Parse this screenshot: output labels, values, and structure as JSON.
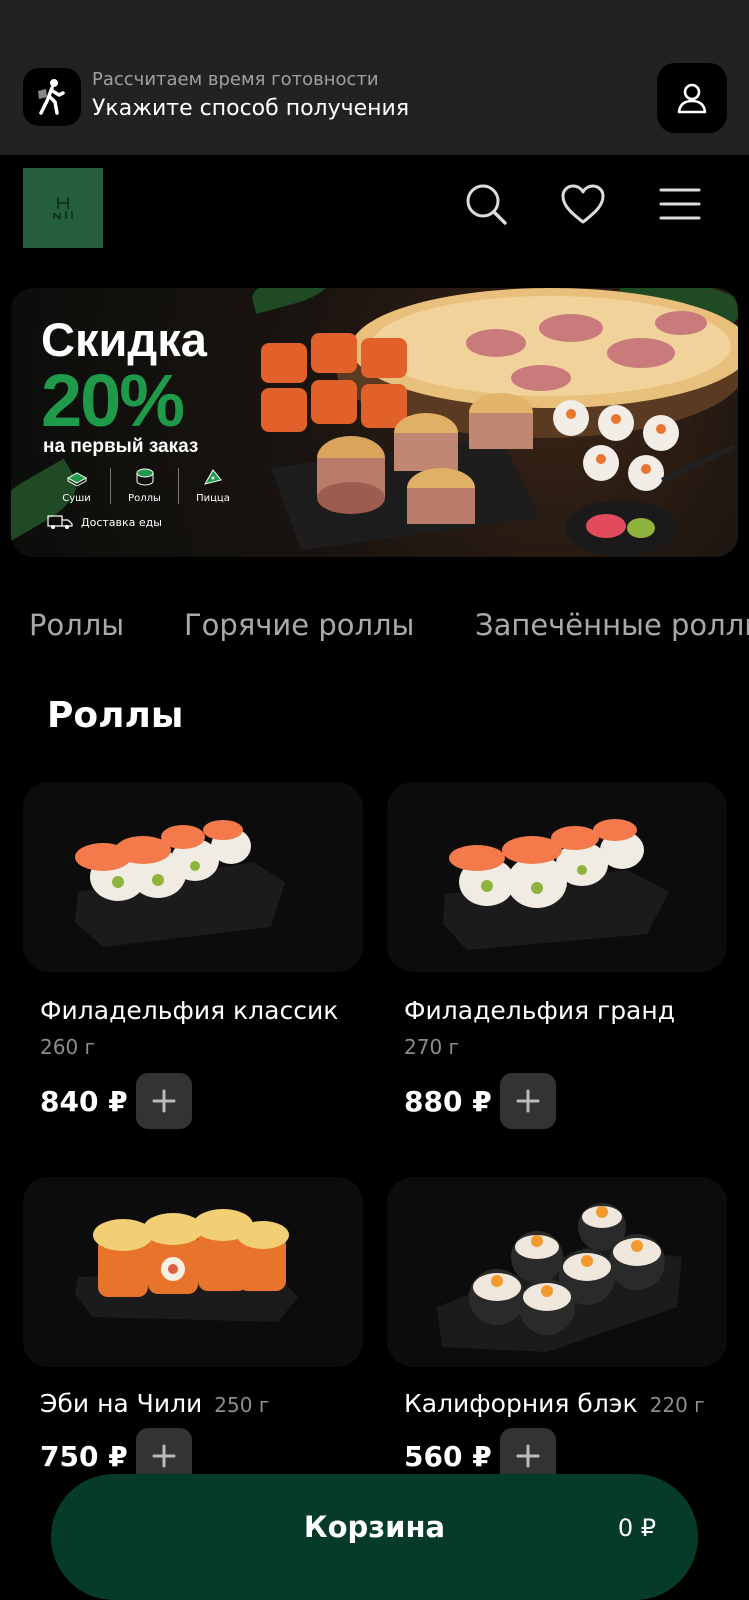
{
  "delivery": {
    "subtitle": "Рассчитаем время готовности",
    "title": "Укажите способ получения"
  },
  "banner": {
    "title": "Скидка",
    "percent": "20%",
    "subtitle": "на первый заказ",
    "categories": [
      "Суши",
      "Роллы",
      "Пицца"
    ],
    "delivery_text": "Доставка еды"
  },
  "tabs": [
    "Роллы",
    "Горячие роллы",
    "Запечённые роллы"
  ],
  "section_title": "Роллы",
  "products": [
    {
      "name": "Филадельфия классик",
      "weight": "260 г",
      "price": "840 ₽"
    },
    {
      "name": "Филадельфия гранд",
      "weight": "270 г",
      "price": "880 ₽"
    },
    {
      "name": "Эби на Чили",
      "weight": "250 г",
      "price": "750 ₽"
    },
    {
      "name": "Калифорния блэк",
      "weight": "220 г",
      "price": "560 ₽"
    }
  ],
  "cart": {
    "label": "Корзина",
    "total": "0 ₽"
  },
  "colors": {
    "accent": "#063b2b",
    "promo_green": "#1f9a4b",
    "bar_bg": "#222222"
  }
}
